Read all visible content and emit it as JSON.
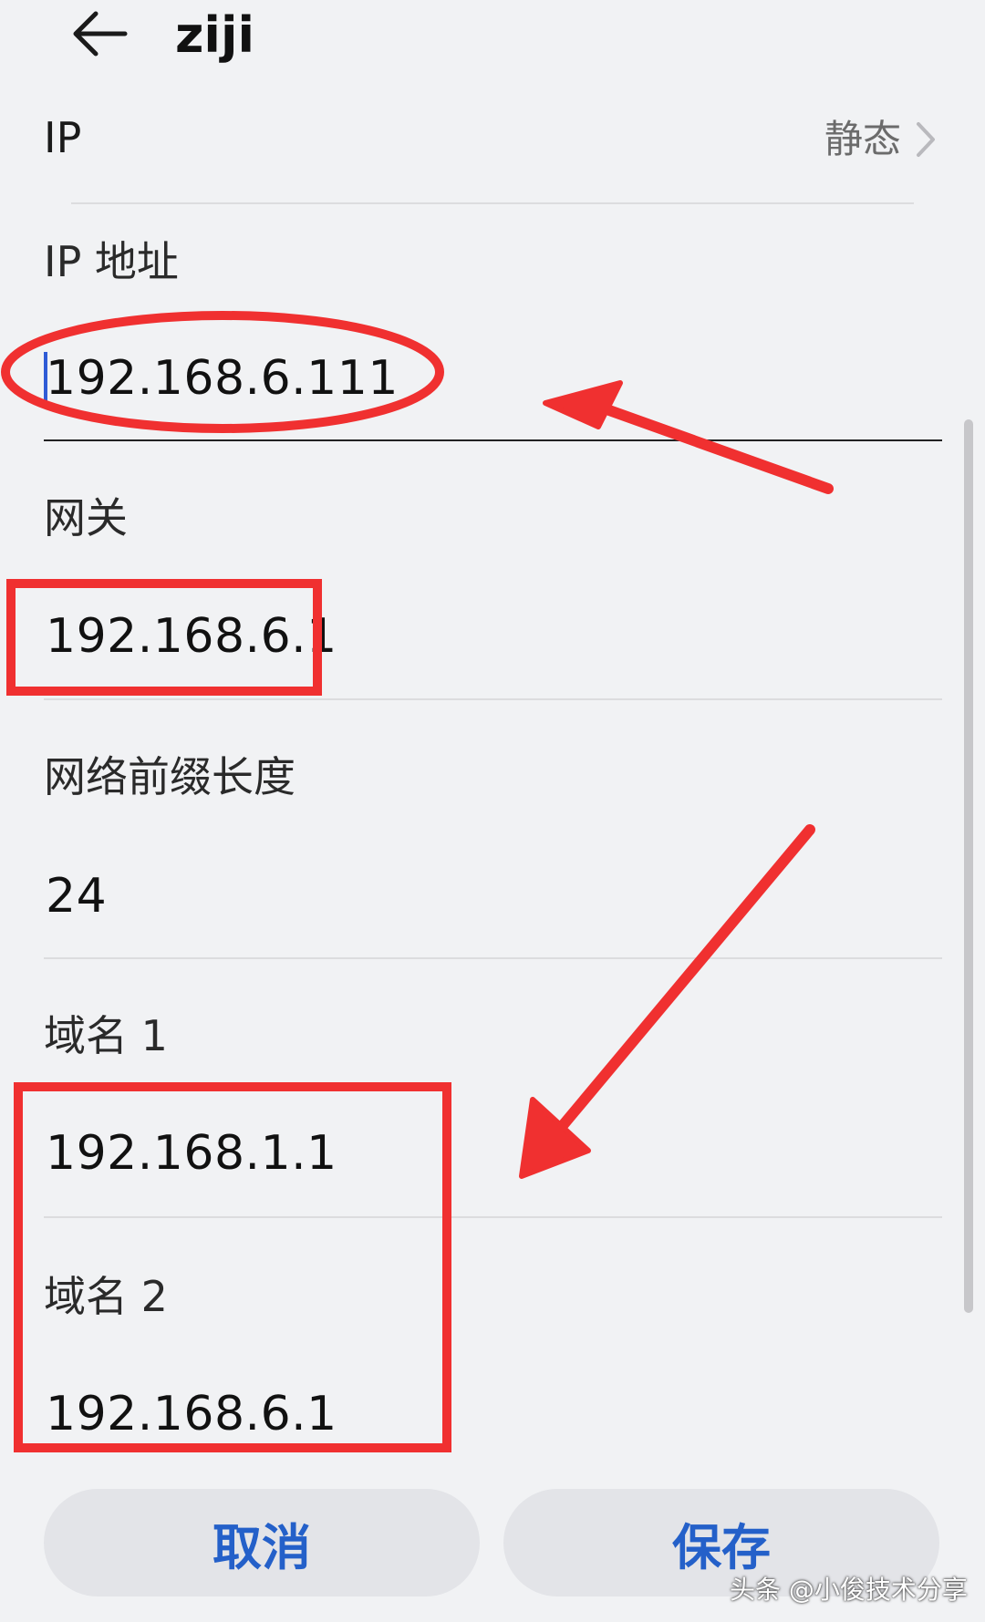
{
  "header": {
    "back_icon": "arrow-left-icon",
    "title": "ziji"
  },
  "ip_setting": {
    "label": "IP",
    "value": "静态",
    "chevron_icon": "chevron-right-icon"
  },
  "fields": {
    "ip_address": {
      "label": "IP 地址",
      "value": "192.168.6.111"
    },
    "gateway": {
      "label": "网关",
      "value": "192.168.6.1"
    },
    "prefix_length": {
      "label": "网络前缀长度",
      "value": "24"
    },
    "dns1": {
      "label": "域名 1",
      "value": "192.168.1.1"
    },
    "dns2": {
      "label": "域名 2",
      "value": "192.168.6.1"
    }
  },
  "buttons": {
    "cancel": "取消",
    "save": "保存"
  },
  "watermark": "头条 @小俊技术分享",
  "colors": {
    "annotation_red": "#f03030",
    "button_text_blue": "#2460c9",
    "background": "#f1f2f4"
  }
}
